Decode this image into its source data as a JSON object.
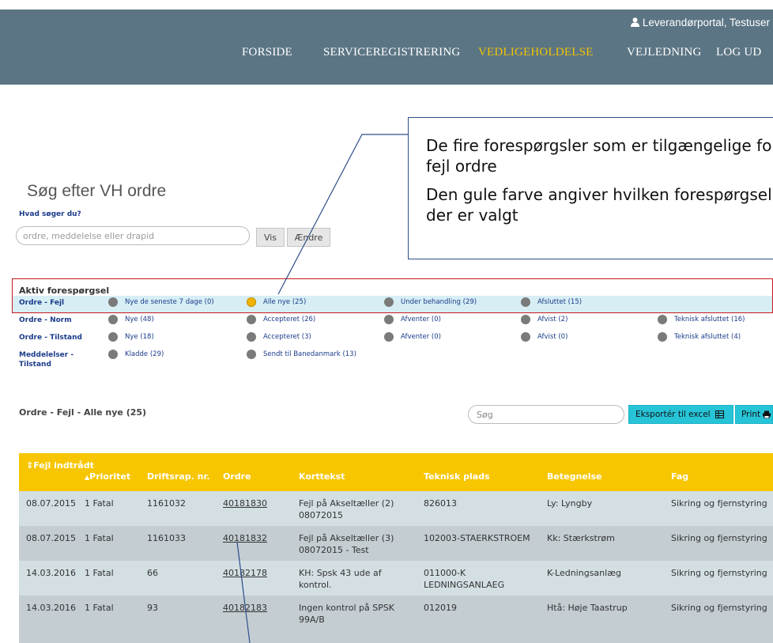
{
  "header": {
    "user_label": "Leverandørportal, Testuser",
    "nav": [
      {
        "label": "FORSIDE"
      },
      {
        "label": "SERVICEREGISTRERING"
      },
      {
        "label": "VEDLIGEHOLDELSE"
      },
      {
        "label": "VEJLEDNING"
      },
      {
        "label": "LOG UD"
      }
    ],
    "active_color": "#f3c400",
    "bar_color": "#5b7584"
  },
  "search": {
    "title": "Søg efter VH ordre",
    "question": "Hvad søger du?",
    "placeholder": "ordre, meddelelse eller drapid",
    "vis_label": "Vis",
    "aendre_label": "Ændre"
  },
  "callout": {
    "line1": "De fire forespørgsler som er tilgængelige for fejl ordre",
    "line2": "Den gule farve angiver hvilken forespørgsel der er valgt"
  },
  "requests": {
    "heading": "Aktiv forespørgsel",
    "groups": [
      {
        "label": "Ordre - Fejl",
        "options": [
          "Nye de seneste 7 dage (0)",
          "Alle nye (25)",
          "Under behandling (29)",
          "Afsluttet (15)"
        ]
      },
      {
        "label": "Ordre - Norm",
        "options": [
          "Nye (48)",
          "Accepteret (26)",
          "Afventer (0)",
          "Afvist (2)",
          "Teknisk afsluttet (16)"
        ]
      },
      {
        "label": "Ordre - Tilstand",
        "options": [
          "Nye (18)",
          "Accepteret (3)",
          "Afventer (0)",
          "Afvist (0)",
          "Teknisk afsluttet (4)"
        ]
      },
      {
        "label": "Meddelelser - Tilstand",
        "options": [
          "Kladde (29)",
          "Sendt til Banedanmark (13)"
        ]
      }
    ],
    "selected": "Alle nye (25)"
  },
  "results": {
    "title": "Ordre - Fejl - Alle nye (25)",
    "search_placeholder": "Søg",
    "export_label": "Eksportér til excel",
    "print_label": "Print",
    "columns": [
      "Fejl indtrådt",
      "Prioritet",
      "Driftsrap. nr.",
      "Ordre",
      "Korttekst",
      "Teknisk plads",
      "Betegnelse",
      "Fag"
    ],
    "rows": [
      [
        "08.07.2015",
        "1 Fatal",
        "1161032",
        "40181830",
        "Fejl på Akseltæller (2) 08072015",
        "826013",
        "Ly: Lyngby",
        "Sikring og fjernstyring"
      ],
      [
        "08.07.2015",
        "1 Fatal",
        "1161033",
        "40181832",
        "Fejl på Akseltæller (3) 08072015 - Test",
        "102003-STAERKSTROEM",
        "Kk: Stærkstrøm",
        "Sikring og fjernstyring"
      ],
      [
        "14.03.2016",
        "1 Fatal",
        "66",
        "40182178",
        "KH: Spsk 43 ude af kontrol.",
        "011000-K LEDNINGSANLAEG",
        "K-Ledningsanlæg",
        "Sikring og fjernstyring"
      ],
      [
        "14.03.2016",
        "1 Fatal",
        "93",
        "40182183",
        "Ingen kontrol på SPSK 99A/B",
        "012019",
        "Htå: Høje Taastrup",
        "Sikring og fjernstyring"
      ]
    ],
    "header_color": "#f7c600",
    "row_colors": [
      "#d3dfe3",
      "#c3cdd2"
    ]
  }
}
